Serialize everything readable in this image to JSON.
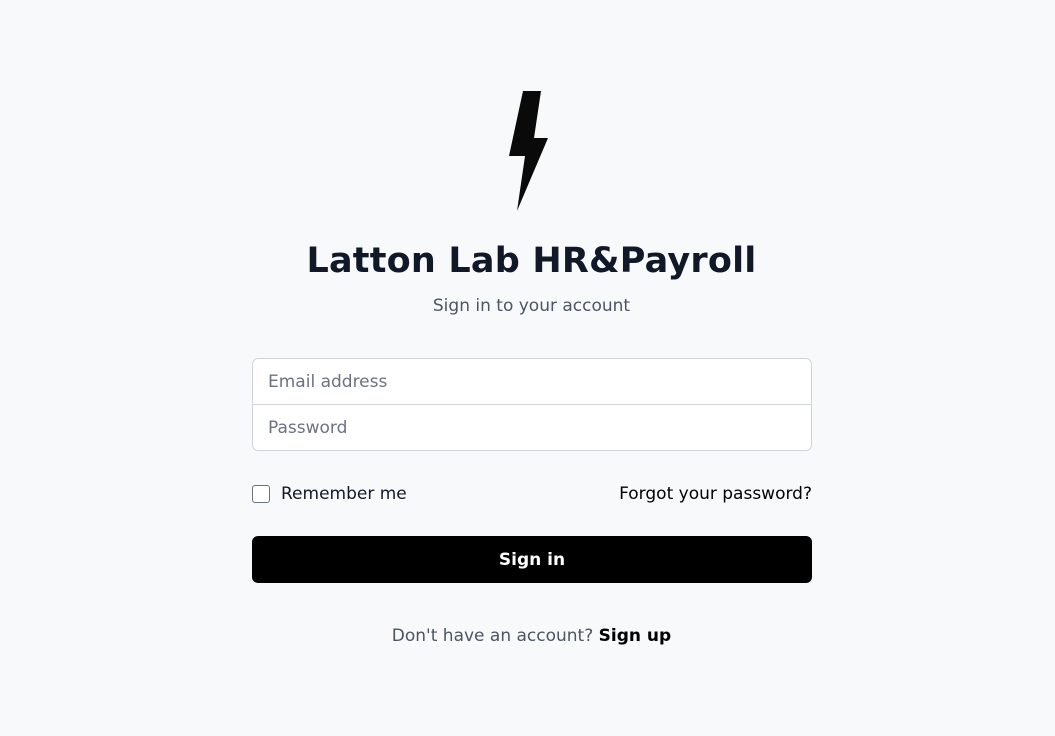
{
  "brand": {
    "logo_icon": "lightning-bolt-icon",
    "title": "Latton Lab HR&Payroll",
    "subtitle": "Sign in to your account"
  },
  "form": {
    "email_placeholder": "Email address",
    "email_value": "",
    "password_placeholder": "Password",
    "password_value": "",
    "remember_label": "Remember me",
    "remember_checked": false,
    "forgot_label": "Forgot your password?",
    "submit_label": "Sign in"
  },
  "footer": {
    "prompt": "Don't have an account?",
    "signup_label": "Sign up"
  },
  "colors": {
    "background": "#f8f9fb",
    "primary": "#000000",
    "text": "#111827",
    "muted": "#4b5563",
    "border": "#d1d5db"
  }
}
